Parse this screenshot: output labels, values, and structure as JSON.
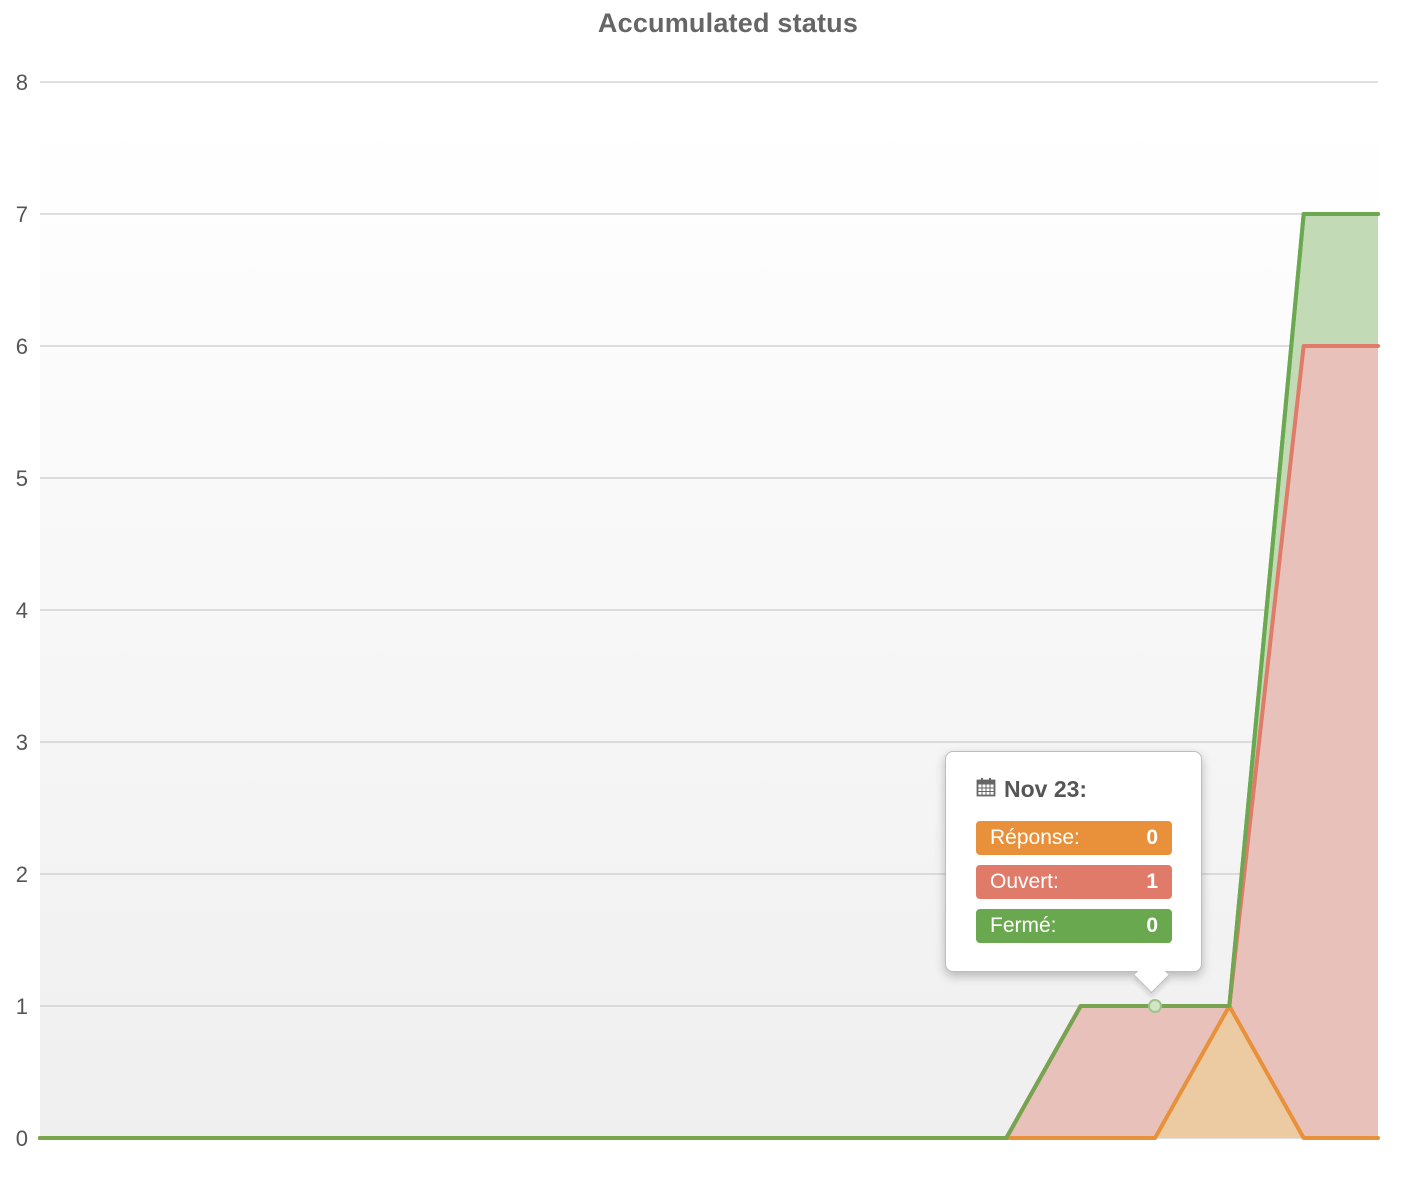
{
  "chart_data": {
    "type": "area",
    "title": "Accumulated status",
    "xlabel": "",
    "ylabel": "",
    "ylim": [
      0,
      8
    ],
    "yticks": [
      "0",
      "1",
      "2",
      "3",
      "4",
      "5",
      "6",
      "7",
      "8"
    ],
    "x": [
      0,
      1,
      2,
      3,
      4,
      5,
      6,
      7,
      8,
      9,
      10,
      11,
      12,
      13,
      14,
      15,
      16,
      17,
      18
    ],
    "stacked": true,
    "grid": true,
    "series": [
      {
        "name": "Réponse",
        "color": "#e8913a",
        "fill": "#eccba3",
        "values": [
          0,
          0,
          0,
          0,
          0,
          0,
          0,
          0,
          0,
          0,
          0,
          0,
          0,
          0,
          0,
          0,
          1,
          0,
          0
        ]
      },
      {
        "name": "Ouvert",
        "color": "#e07b6a",
        "fill": "#e9c1bb",
        "values": [
          0,
          0,
          0,
          0,
          0,
          0,
          0,
          0,
          0,
          0,
          0,
          0,
          0,
          0,
          1,
          1,
          0,
          6,
          6
        ]
      },
      {
        "name": "Fermé",
        "color": "#6aa84f",
        "fill": "#c2dab6",
        "values": [
          0,
          0,
          0,
          0,
          0,
          0,
          0,
          0,
          0,
          0,
          0,
          0,
          0,
          0,
          0,
          0,
          0,
          1,
          1
        ]
      }
    ],
    "tooltip": {
      "point_index": 15,
      "date": "Nov 23:",
      "items": [
        {
          "label": "Réponse:",
          "value": "0",
          "color": "#e8913a"
        },
        {
          "label": "Ouvert:",
          "value": "1",
          "color": "#e07b6a"
        },
        {
          "label": "Fermé:",
          "value": "0",
          "color": "#6aa84f"
        }
      ]
    },
    "colors": {
      "background_top": "#ffffff",
      "background_bottom": "#efefef",
      "grid": "#cccccc",
      "tick_text": "#555555"
    }
  }
}
